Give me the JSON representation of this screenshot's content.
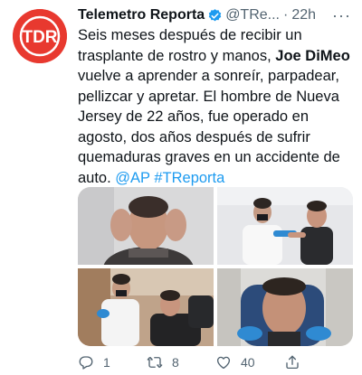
{
  "account": {
    "avatar_text": "TDR",
    "name": "Telemetro Reporta",
    "handle": "@TRe...",
    "separator": "·",
    "time": "22h",
    "more": "···"
  },
  "tweet": {
    "text_1": "Seis meses después de recibir un trasplante de rostro y manos, ",
    "bold": "Joe DiMeo",
    "text_2": " vuelve a aprender a sonreír, parpadear, pellizcar y apretar. El hombre de Nueva Jersey de 22 años, fue operado en agosto, dos años después de sufrir quemaduras graves en un accidente de auto. ",
    "mention": "@AP",
    "hashtag": "#TReporta"
  },
  "actions": {
    "replies": "1",
    "retweets": "8",
    "likes": "40"
  },
  "colors": {
    "brand_red": "#e8392f",
    "link_blue": "#1d9bf0",
    "secondary_text": "#536471"
  }
}
